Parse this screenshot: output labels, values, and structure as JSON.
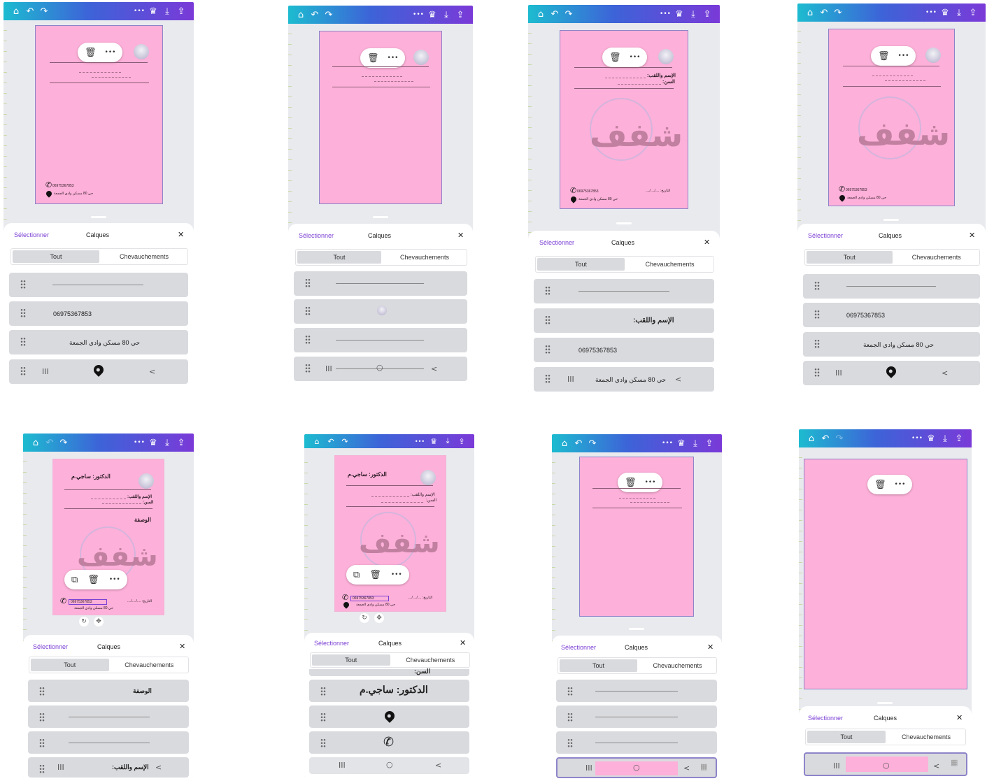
{
  "toolbar": {
    "dots": "•••",
    "delete_icon": "🗑",
    "copy_icon": "⧉"
  },
  "topbar": {
    "home": "⌂",
    "undo": "↶",
    "redo": "↷",
    "more": "•••",
    "crown": "♛",
    "download": "⤓",
    "share": "⇪"
  },
  "panel": {
    "select_label": "Sélectionner",
    "title": "Calques",
    "close": "✕",
    "tab_all": "Tout",
    "tab_overlap": "Chevauchements"
  },
  "doc": {
    "phone_number": "06975367853",
    "address": "حي 80 مسكن وادي الجمعة",
    "name_label": "الإسم واللقب:",
    "age_label": "السن:",
    "doctor": "الدكتور: ساجي.م",
    "prescription": "الوصفة",
    "date": "التاريخ: ..../..../....",
    "watermark": "شفف"
  },
  "layers": {
    "phone_row": "06975367853",
    "address_row": "حي 80 مسكن وادي الجمعة",
    "name_row": "الإسم واللقب:",
    "doctor_row": "الدكتور: ساجي.م",
    "prescription_row": "الوصفة",
    "age_row": "السن:",
    "nav_back": "<",
    "nav_recent": "III",
    "nav_home": "○"
  },
  "colors": {
    "page_pink": "#fdb0d9",
    "accent_purple": "#7b3fd4",
    "row_gray": "#d9dade"
  }
}
